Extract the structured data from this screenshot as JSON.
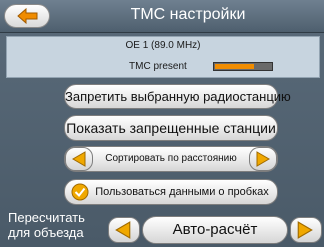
{
  "header": {
    "title": "ТМС настройки"
  },
  "station": {
    "name": "OE 1 (89.0 MHz)",
    "tmc_label": "TMC present",
    "tmc_signal_level": 0.7
  },
  "buttons": {
    "block_station": "Запретить выбранную радиостанцию",
    "show_blocked": "Показать запрещенные станции"
  },
  "sort": {
    "label": "Сортировать по расстоянию"
  },
  "traffic": {
    "label": "Пользоваться данными о пробках",
    "checked": true
  },
  "recalc": {
    "label": "Пересчитать для объезда",
    "value": "Авто-расчёт"
  },
  "colors": {
    "accent": "#f08c00",
    "panel": "#c7d4df",
    "background": "#4e5f6e"
  }
}
